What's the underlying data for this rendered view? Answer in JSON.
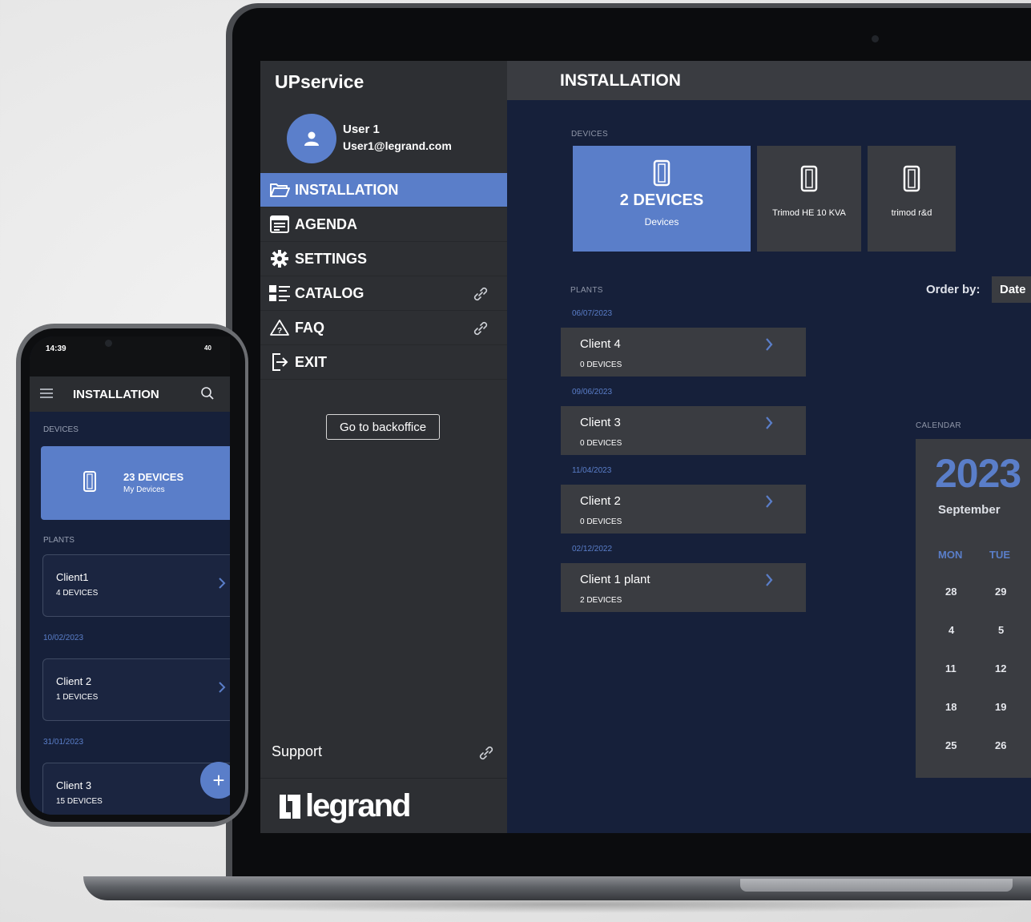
{
  "laptop": {
    "app_name": "UPservice",
    "user": {
      "name": "User 1",
      "email": "User1@legrand.com"
    },
    "nav": [
      {
        "label": "INSTALLATION",
        "icon": "folder-icon",
        "active": true,
        "link": false
      },
      {
        "label": "AGENDA",
        "icon": "agenda-icon",
        "active": false,
        "link": false
      },
      {
        "label": "SETTINGS",
        "icon": "gear-icon",
        "active": false,
        "link": false
      },
      {
        "label": "CATALOG",
        "icon": "catalog-icon",
        "active": false,
        "link": true
      },
      {
        "label": "FAQ",
        "icon": "warning-icon",
        "active": false,
        "link": true
      },
      {
        "label": "EXIT",
        "icon": "exit-icon",
        "active": false,
        "link": false
      }
    ],
    "backoffice_label": "Go to backoffice",
    "support_label": "Support",
    "logo_text": "legrand",
    "header_title": "INSTALLATION",
    "devices_label": "DEVICES",
    "devices": [
      {
        "title": "2 DEVICES",
        "subtitle": "Devices"
      },
      {
        "title": "Trimod HE 10 KVA"
      },
      {
        "title": "trimod r&d"
      }
    ],
    "plants_label": "PLANTS",
    "order_by_label": "Order by:",
    "order_by_value": "Date",
    "plants": [
      {
        "date": "06/07/2023",
        "name": "Client 4",
        "devices": "0 DEVICES"
      },
      {
        "date": "09/06/2023",
        "name": "Client 3",
        "devices": "0 DEVICES"
      },
      {
        "date": "11/04/2023",
        "name": "Client 2",
        "devices": "0 DEVICES"
      },
      {
        "date": "02/12/2022",
        "name": "Client 1 plant",
        "devices": "2 DEVICES"
      }
    ],
    "calendar": {
      "label": "CALENDAR",
      "year": "2023",
      "month": "September",
      "days": [
        "MON",
        "TUE"
      ],
      "weeks": [
        [
          "28",
          "29"
        ],
        [
          "4",
          "5"
        ],
        [
          "11",
          "12"
        ],
        [
          "18",
          "19"
        ],
        [
          "25",
          "26"
        ]
      ]
    }
  },
  "phone": {
    "time": "14:39",
    "battery": "40",
    "title": "INSTALLATION",
    "devices_label": "DEVICES",
    "device_card": {
      "title": "23 DEVICES",
      "subtitle": "My Devices"
    },
    "plants_label": "PLANTS",
    "plants": [
      {
        "date": "",
        "name": "Client1",
        "devices": "4 DEVICES"
      },
      {
        "date": "10/02/2023",
        "name": "Client 2",
        "devices": "1 DEVICES"
      },
      {
        "date": "31/01/2023",
        "name": "Client 3",
        "devices": "15 DEVICES"
      }
    ],
    "fab_label": "+"
  },
  "colors": {
    "accent": "#5a7ec9",
    "panel": "#3a3c41",
    "sidebar": "#2d2f33",
    "background": "#16203a"
  }
}
